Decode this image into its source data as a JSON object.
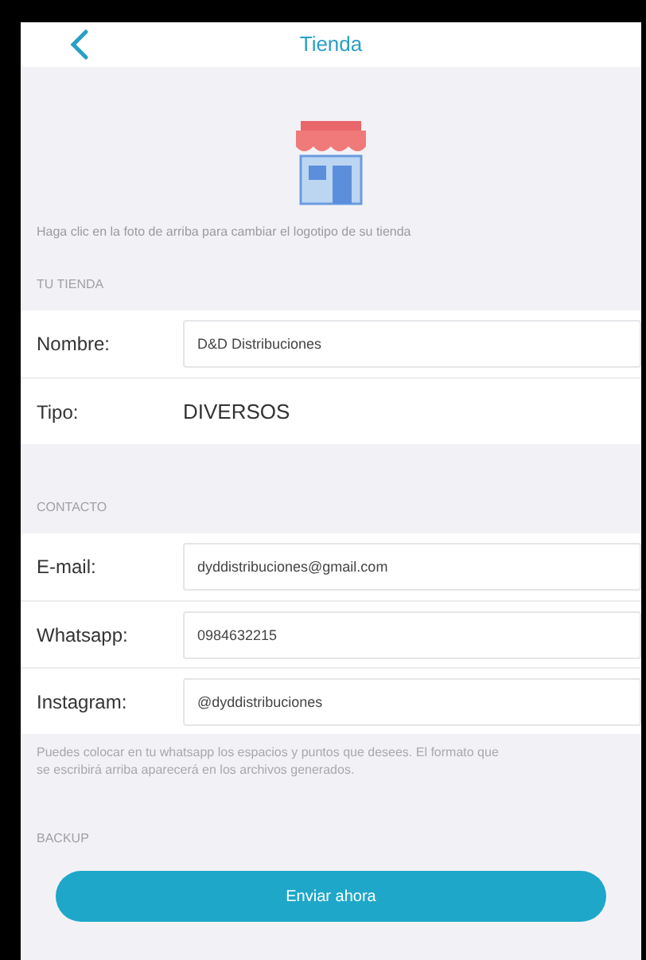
{
  "header": {
    "title": "Tienda"
  },
  "logo_hint": "Haga clic en la foto de arriba para cambiar el logotipo de su tienda",
  "sections": [
    {
      "title": "TU TIENDA",
      "rows": [
        {
          "label": "Nombre:",
          "value": "D&D Distribuciones",
          "kind": "input"
        },
        {
          "label": "Tipo:",
          "value": "DIVERSOS",
          "kind": "picker"
        }
      ]
    },
    {
      "title": "CONTACTO",
      "rows": [
        {
          "label": "E-mail:",
          "value": "dyddistribuciones@gmail.com",
          "kind": "input"
        },
        {
          "label": "Whatsapp:",
          "value": "0984632215",
          "kind": "input"
        },
        {
          "label": "Instagram:",
          "value": "@dyddistribuciones",
          "kind": "input"
        }
      ],
      "note": "Puedes colocar en tu whatsapp los espacios y puntos que desees. El formato que se escribirá arriba aparecerá en los archivos generados."
    }
  ],
  "backup": {
    "title": "BACKUP",
    "button": "Enviar ahora"
  }
}
